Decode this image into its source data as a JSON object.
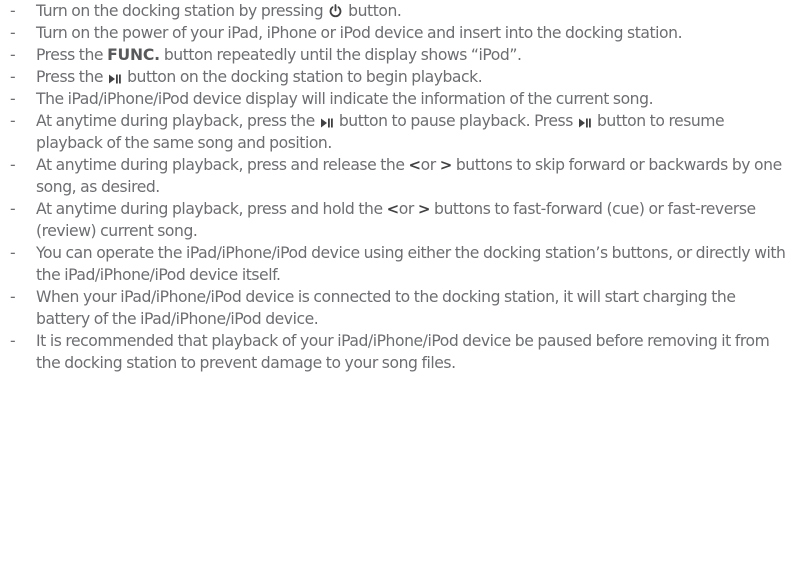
{
  "dash": "-",
  "items": [
    {
      "a": "Turn on the docking station by pressing",
      "b": "button."
    },
    {
      "a": "Turn on the power of your iPad, iPhone or iPod device and insert into the docking station."
    },
    {
      "a": "Press the",
      "bold": "FUNC.",
      "b": "button repeatedly until the display shows “iPod”."
    },
    {
      "a": "Press the",
      "b": "button on the docking station to begin playback."
    },
    {
      "a": "The iPad/iPhone/iPod device display will indicate the information of the current song."
    },
    {
      "a": "At anytime during playback, press the",
      "b": "button to pause playback. Press",
      "c": "button to resume playback of the same song and position."
    },
    {
      "a": "At anytime during playback, press and release the",
      "lt": "<",
      "or": "or",
      "gt": ">",
      "b": "buttons to skip forward or backwards by one song, as desired."
    },
    {
      "a": "At anytime during playback, press and hold the",
      "lt": "<",
      "or": "or",
      "gt": ">",
      "b": "buttons to fast-forward (cue) or fast-reverse (review) current song."
    },
    {
      "a": "You can operate the iPad/iPhone/iPod device using either the docking station’s buttons, or directly with the iPad/iPhone/iPod device itself."
    },
    {
      "a": "When your iPad/iPhone/iPod device is connected to the docking station, it will start charging the battery of the iPad/iPhone/iPod device."
    },
    {
      "a": "It is recommended that playback of your iPad/iPhone/iPod device be paused before removing it from the docking station to prevent damage to your song files."
    }
  ],
  "icons": {
    "power": "power-icon",
    "play_pause": "play-pause-icon",
    "prev": "chevron-left-icon",
    "next": "chevron-right-icon"
  }
}
